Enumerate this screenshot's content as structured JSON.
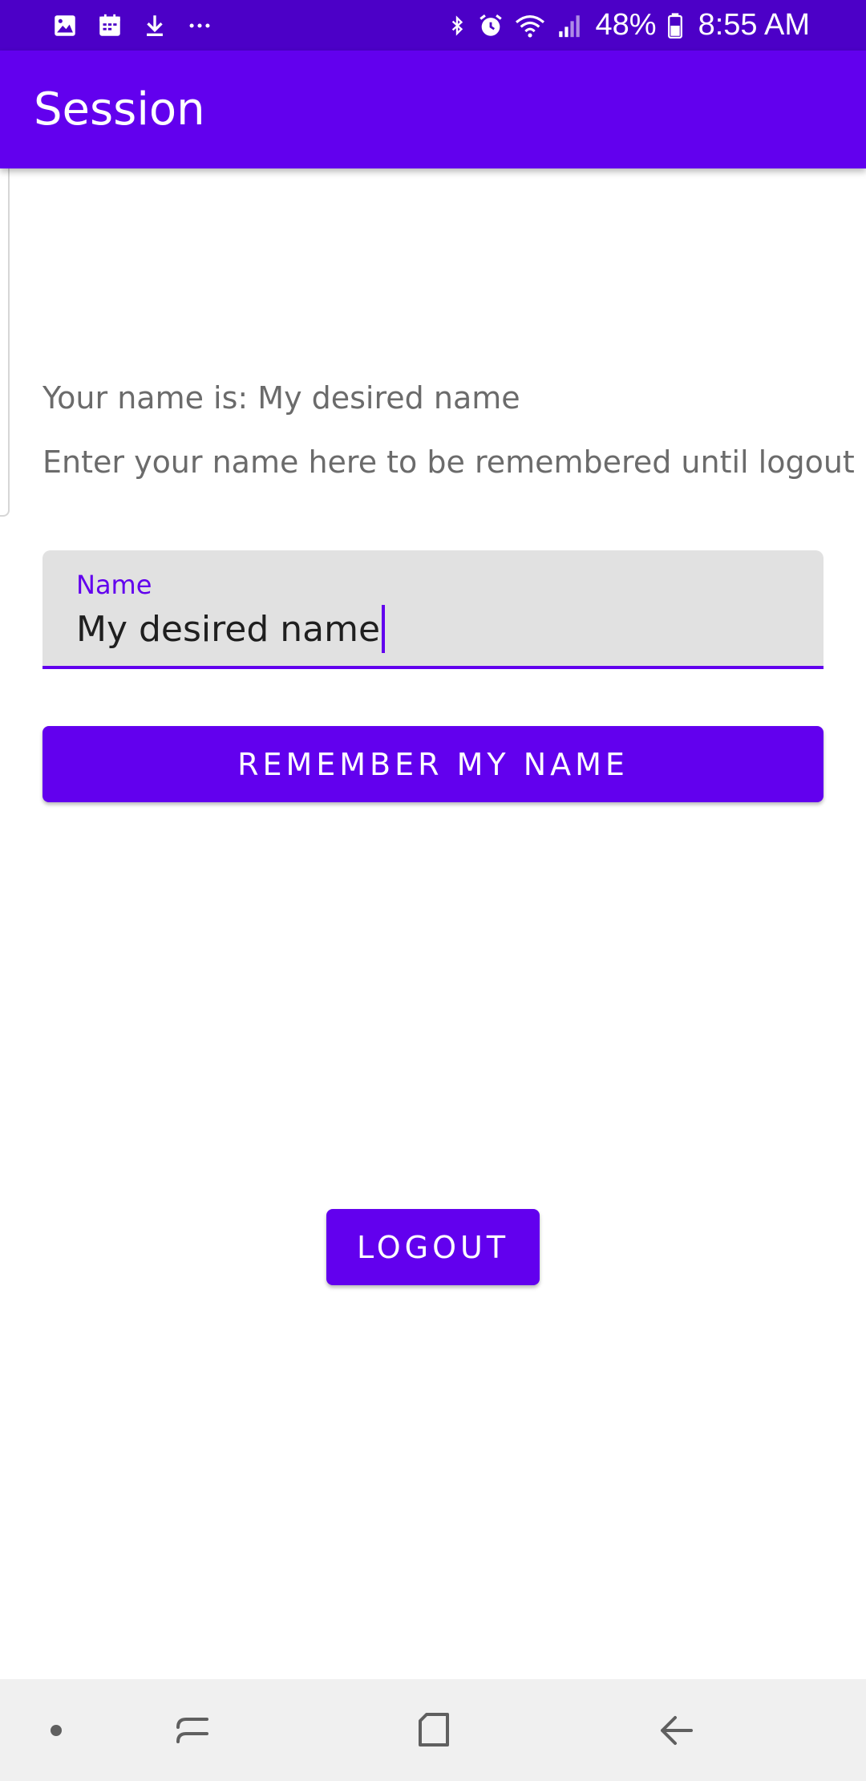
{
  "status_bar": {
    "notification_icons": [
      "image-icon",
      "calendar-icon",
      "download-icon",
      "more-dots-icon"
    ],
    "system_icons": [
      "bluetooth-icon",
      "alarm-icon",
      "wifi-icon",
      "signal-icon"
    ],
    "battery_percent": "48%",
    "time": "8:55 AM",
    "color": "#4c00c7"
  },
  "app_bar": {
    "title": "Session",
    "color": "#6200ee"
  },
  "content": {
    "name_display": "Your name is: My desired name",
    "instructions": "Enter your name here to be remembered until logout",
    "name_field": {
      "label": "Name",
      "value": "My desired name"
    },
    "remember_button": "REMEMBER MY NAME",
    "logout_button": "LOGOUT"
  },
  "nav_bar": {
    "items": [
      "dot-icon",
      "recent-apps-icon",
      "home-icon",
      "back-icon"
    ]
  },
  "colors": {
    "accent": "#6200ee",
    "status_bar": "#4c00c7",
    "field_background": "#e1e1e1",
    "secondary_text": "#6b6b6b"
  }
}
